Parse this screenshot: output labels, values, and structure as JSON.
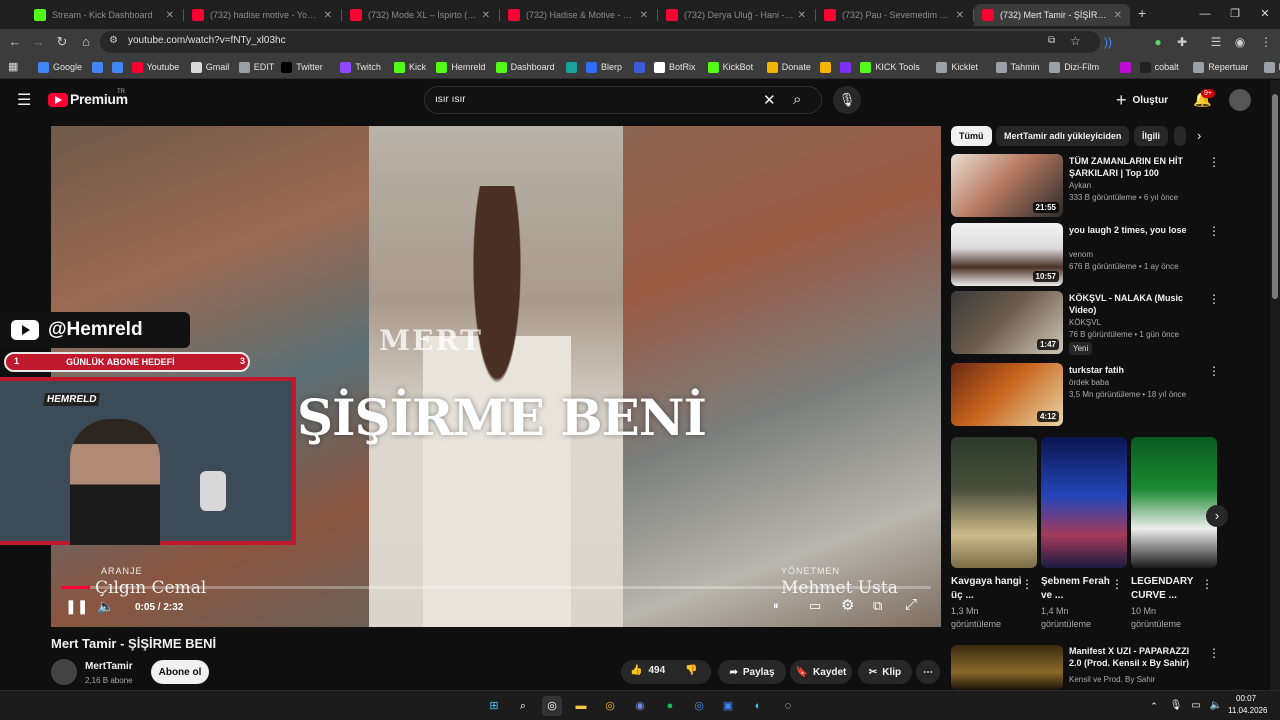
{
  "browser": {
    "tabs": [
      {
        "title": "Stream - Kick Dashboard",
        "fav": "#53fc18",
        "active": false
      },
      {
        "title": "(732) hadise motive - YouTube",
        "fav": "#ff0033",
        "active": false
      },
      {
        "title": "(732) Mode XL – İspirto (Offici...",
        "fav": "#ff0033",
        "active": false
      },
      {
        "title": "(732) Hadise & Motive - Labirent",
        "fav": "#ff0033",
        "active": false
      },
      {
        "title": "(732) Derya Uluğ - Hani - YouT...",
        "fav": "#ff0033",
        "active": false
      },
      {
        "title": "(732) Pau - Sevemedim Karag...",
        "fav": "#ff0033",
        "active": false
      },
      {
        "title": "(732) Mert Tamir - ŞİŞİRME",
        "fav": "#ff0033",
        "active": true
      }
    ],
    "new_tab": "+",
    "url": "youtube.com/watch?v=fNTy_xl03hc",
    "bookmarks": [
      {
        "label": "Google",
        "color": "#4285f4"
      },
      {
        "label": "",
        "color": "#4285f4"
      },
      {
        "label": "",
        "color": "#4285f4"
      },
      {
        "label": "Youtube",
        "color": "#ff0033"
      },
      {
        "label": "Gmail",
        "color": "#d9d9d9"
      },
      {
        "label": "EDIT",
        "color": "#9aa0a6"
      },
      {
        "label": "Twitter",
        "color": "#000000"
      },
      {
        "label": "Twitch",
        "color": "#9146ff"
      },
      {
        "label": "Kick",
        "color": "#53fc18"
      },
      {
        "label": "Hemreld",
        "color": "#53fc18"
      },
      {
        "label": "Dashboard",
        "color": "#53fc18"
      },
      {
        "label": "",
        "color": "#1aa39a"
      },
      {
        "label": "Blerp",
        "color": "#2f6dff"
      },
      {
        "label": "",
        "color": "#3b5bdb"
      },
      {
        "label": "BotRix",
        "color": "#ffffff"
      },
      {
        "label": "KickBot",
        "color": "#53fc18"
      },
      {
        "label": "Donate",
        "color": "#f4b400"
      },
      {
        "label": "",
        "color": "#f4b400"
      },
      {
        "label": "",
        "color": "#7b2ff7"
      },
      {
        "label": "KICK Tools",
        "color": "#53fc18"
      },
      {
        "label": "Kicklet",
        "color": "#9aa0a6"
      },
      {
        "label": "Tahmin",
        "color": "#9aa0a6"
      },
      {
        "label": "Dizi-Film",
        "color": "#9aa0a6"
      },
      {
        "label": "",
        "color": "#c00bd4"
      },
      {
        "label": "cobalt",
        "color": "#222222"
      },
      {
        "label": "Repertuar",
        "color": "#9aa0a6"
      },
      {
        "label": "Looper",
        "color": "#9aa0a6"
      }
    ]
  },
  "youtube": {
    "logo": "Premium",
    "logo_sup": "TR",
    "search_query": "ısır ısır",
    "create_label": "Oluştur",
    "notif_badge": "9+",
    "video_title": "Mert Tamir - ŞİŞİRME BENİ",
    "channel": {
      "name": "MertTamir",
      "subs": "2,16 B abone"
    },
    "subscribe_label": "Abone ol",
    "actions": {
      "likes": "494",
      "share": "Paylaş",
      "save": "Kaydet",
      "clip": "Klip"
    },
    "player": {
      "time": "0:05 / 2:32",
      "title_overlay": "ŞİŞİRME BENİ",
      "artist_overlay": "MERT",
      "arranger_caption": "ARANJE",
      "arranger_name": "Çılgın Cemal",
      "director_caption": "YÖNETMEN",
      "director_name": "Mehmet Usta",
      "progress": 0.033
    },
    "overlay": {
      "handle": "@Hemreld",
      "goal_label": "GÜNLÜK ABONE HEDEFİ",
      "goal_current": "1",
      "goal_target": "3",
      "cam_logo": "HEMRELD"
    },
    "chips": [
      "Tümü",
      "MertTamir adlı yükleyiciden",
      "İlgili"
    ],
    "recommendations": [
      {
        "title": "TÜM ZAMANLARIN EN HİT ŞARKILARI | Top 100",
        "channel": "Aykan",
        "meta": "333 B görüntüleme • 6 yıl önce",
        "duration": "21:55",
        "badge": ""
      },
      {
        "title": "you laugh 2 times, you lose",
        "channel": "venom",
        "meta": "676 B görüntüleme • 1 ay önce",
        "duration": "10:57",
        "badge": ""
      },
      {
        "title": "KÖKŞVL - NALAKA (Music Video)",
        "channel": "KÖKŞVL",
        "meta": "76 B görüntüleme • 1 gün önce",
        "duration": "1:47",
        "badge": "Yeni"
      },
      {
        "title": "turkstar fatih",
        "channel": "ördek baba",
        "meta": "3,5 Mn görüntüleme • 18 yıl önce",
        "duration": "4:12",
        "badge": ""
      }
    ],
    "shorts": [
      {
        "title": "Kavgaya hangi üç ...",
        "views": "1,3 Mn",
        "views_label": "görüntüleme"
      },
      {
        "title": "Şebnem Ferah ve ...",
        "views": "1,4 Mn",
        "views_label": "görüntüleme"
      },
      {
        "title": "LEGENDARY CURVE ...",
        "views": "10 Mn",
        "views_label": "görüntüleme"
      }
    ],
    "last_rec": {
      "title": "Manifest X UZI - PAPARAZZI 2.0 (Prod. Kensil x By Sahir)",
      "channel": "Kensil ve Prod. By Sahir"
    }
  },
  "taskbar": {
    "time": "00:07",
    "date": "11.04.2026"
  }
}
